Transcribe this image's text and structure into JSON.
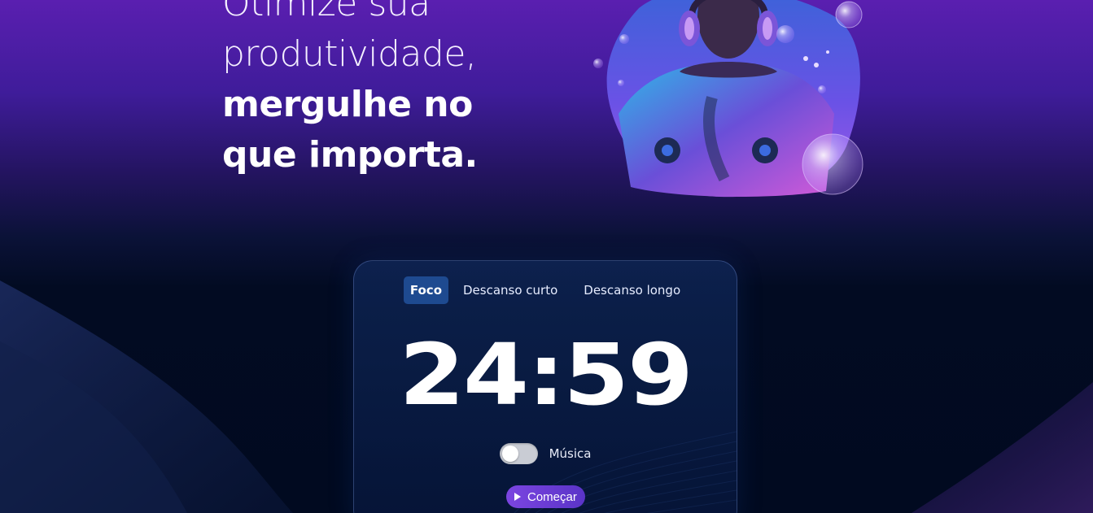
{
  "hero": {
    "line1": "Otimize sua",
    "line2": "produtividade,",
    "line3": "mergulhe no",
    "line4": "que importa."
  },
  "timer": {
    "tabs": [
      {
        "label": "Foco",
        "active": true
      },
      {
        "label": "Descanso curto",
        "active": false
      },
      {
        "label": "Descanso longo",
        "active": false
      }
    ],
    "display": "24:59",
    "music_label": "Música",
    "music_on": false,
    "start_label": "Começar"
  },
  "colors": {
    "accent": "#7b45e0",
    "active_tab": "#1e4a90",
    "background_top": "#5a1fb0",
    "background_bottom": "#010a20"
  },
  "icons": {
    "play": "play-icon",
    "figure": "diver-headphones-illustration"
  }
}
